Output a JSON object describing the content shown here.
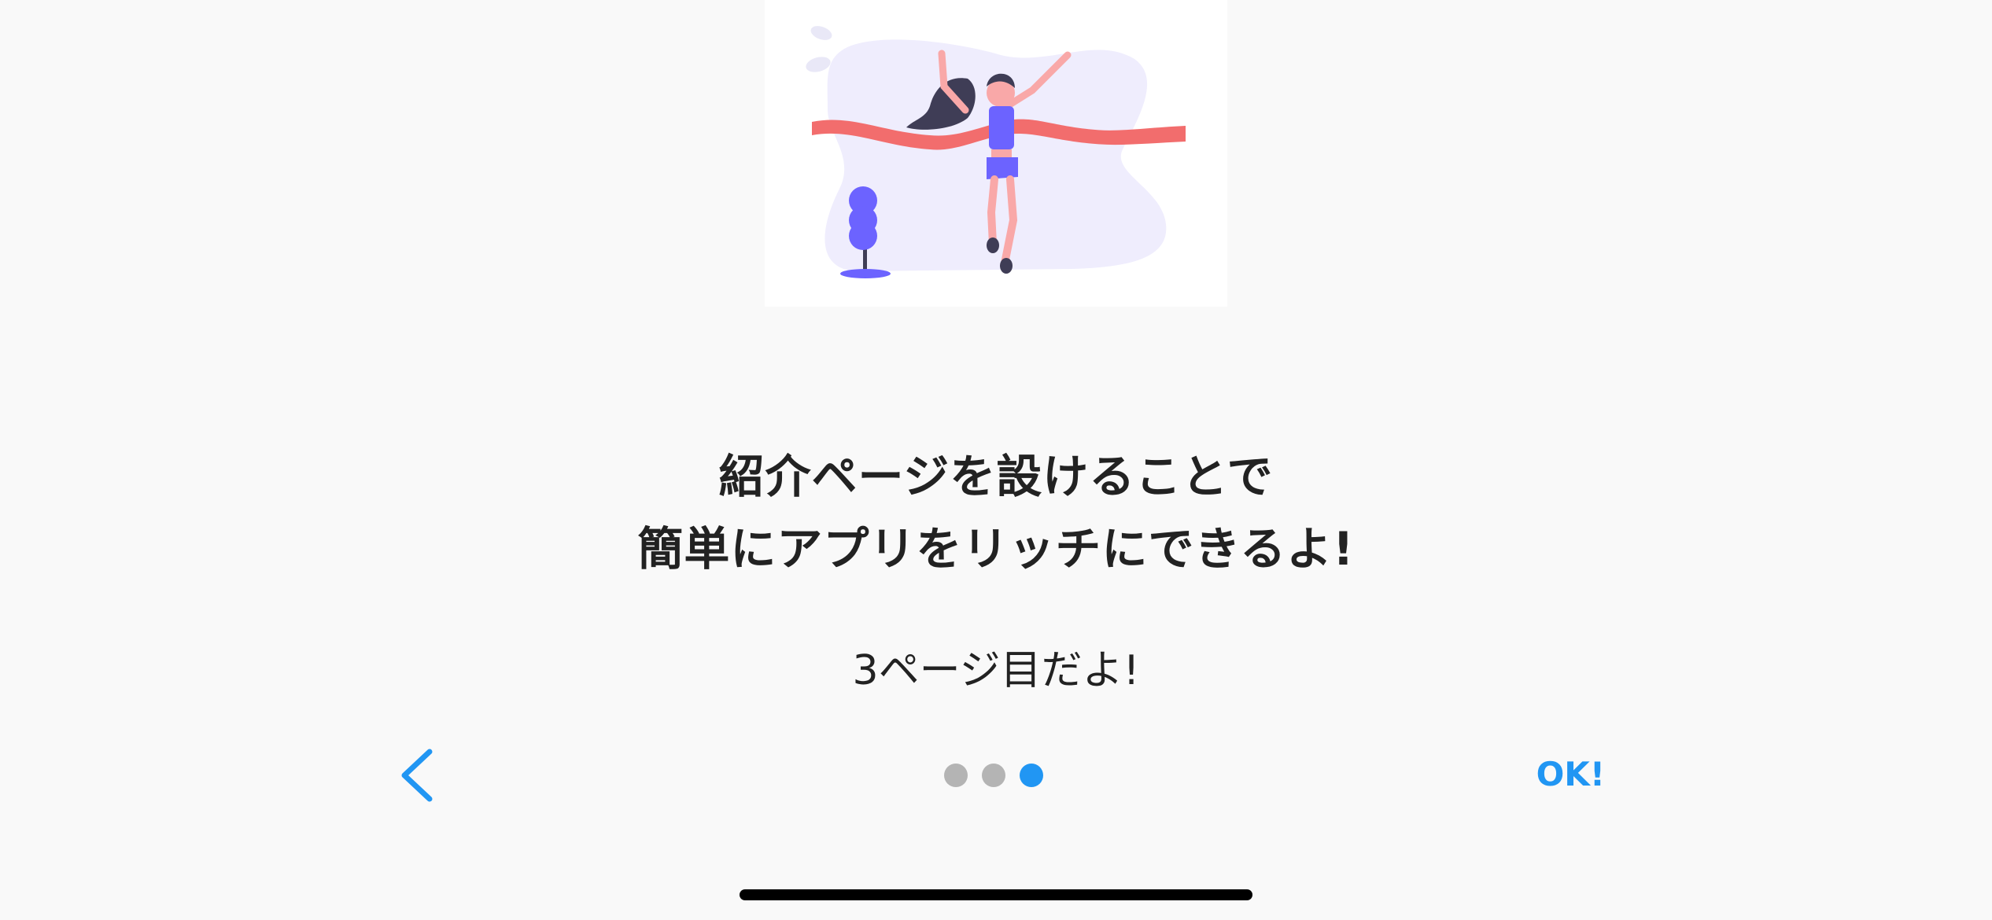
{
  "illustration": {
    "icon": "finish-line-runner-illustration",
    "accent_color": "#6c63ff",
    "ribbon_color": "#f26d6d",
    "blob_color": "#efedfd"
  },
  "title": {
    "line1": "紹介ページを設けることで",
    "line2": "簡単にアプリをリッチにできるよ!"
  },
  "subtitle": "3ページ目だよ!",
  "navigation": {
    "back_icon": "chevron-left-icon",
    "ok_label": "OK!",
    "accent_color": "#2196f3",
    "page_count": 3,
    "current_page": 3
  }
}
